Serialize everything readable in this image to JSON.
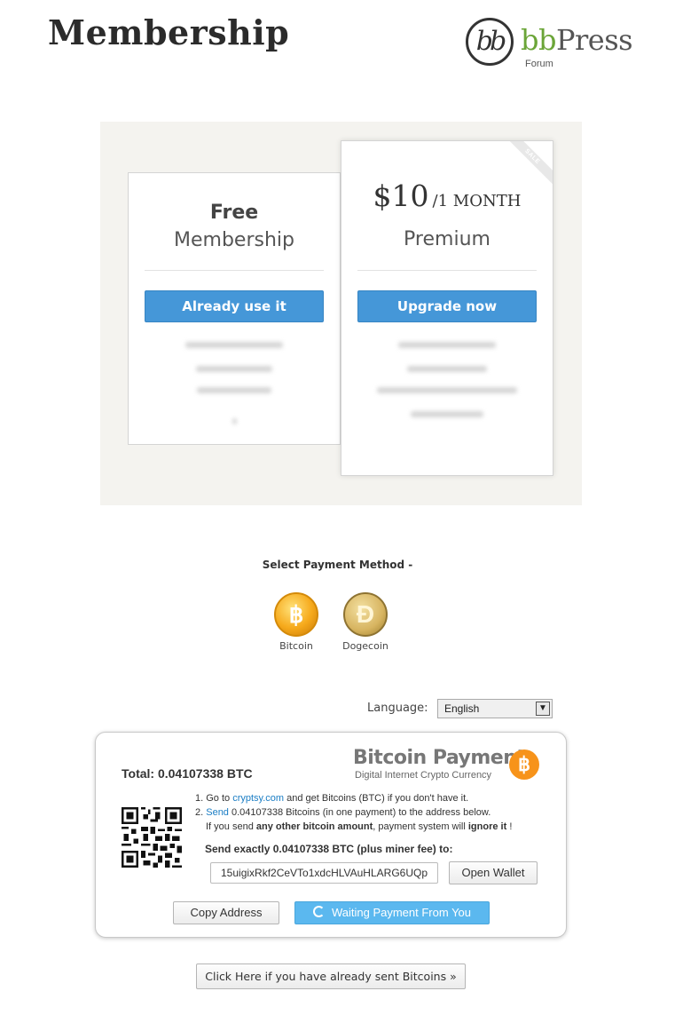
{
  "header": {
    "title": "Membership"
  },
  "logo": {
    "mark": "bb",
    "name_bb": "bb",
    "name_press": "Press",
    "sub": "Forum"
  },
  "plans": {
    "free": {
      "title_line1": "Free",
      "title_line2": "Membership",
      "button": "Already use it"
    },
    "premium": {
      "ribbon": "SALE",
      "price": "$10",
      "period": "/1 MONTH",
      "name": "Premium",
      "button": "Upgrade now"
    }
  },
  "payment_method": {
    "prompt": "Select Payment Method -",
    "options": [
      {
        "label": "Bitcoin",
        "icon": "bitcoin-coin-icon"
      },
      {
        "label": "Dogecoin",
        "icon": "dogecoin-coin-icon"
      }
    ]
  },
  "language": {
    "label": "Language:",
    "selected": "English"
  },
  "bitcoin_payment": {
    "total_label": "Total:",
    "total_amount": "0.04107338",
    "total_unit": "BTC",
    "header_title": "Bitcoin Payment",
    "header_subtitle": "Digital Internet Crypto Currency",
    "badge_symbol": "฿",
    "step1_prefix": "1. Go to ",
    "step1_link": "cryptsy.com",
    "step1_suffix": " and get Bitcoins (BTC) if you don't have it.",
    "step2_prefix": "2. ",
    "step2_link": "Send",
    "step2_suffix": " 0.04107338 Bitcoins (in one payment) to the address below.",
    "warn_prefix": "If you send ",
    "warn_bold1": "any other bitcoin amount",
    "warn_mid": ", payment system will ",
    "warn_bold2": "ignore it",
    "warn_suffix": " !",
    "send_exact": "Send exactly 0.04107338 BTC (plus miner fee) to:",
    "address": "15uigixRkf2CeVTo1xdcHLVAuHLARG6UQp",
    "open_wallet": "Open Wallet",
    "copy_address": "Copy Address",
    "waiting": "Waiting Payment From You"
  },
  "already_sent": "Click Here if you have already sent Bitcoins »",
  "colors": {
    "primary_button": "#4597d8",
    "waiting_button": "#5bb8ef",
    "bitcoin_orange": "#f7931a",
    "link": "#1a7dc4",
    "bbpress_green": "#6ba538"
  }
}
